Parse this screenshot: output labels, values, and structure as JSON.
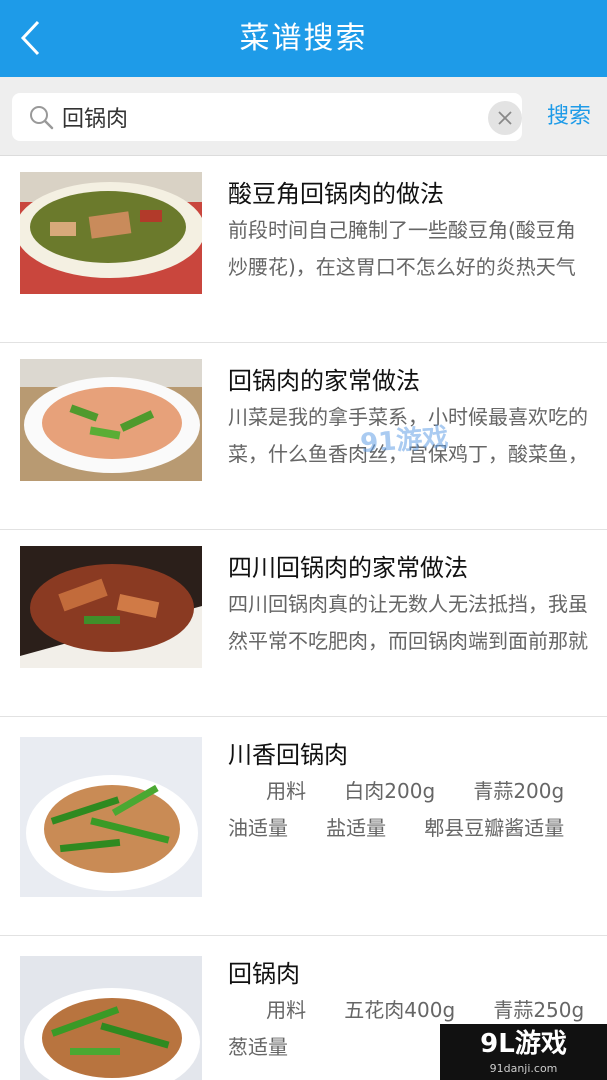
{
  "header": {
    "title": "菜谱搜索",
    "back_icon": "chevron-left-icon"
  },
  "search": {
    "value": "回锅肉",
    "button_label": "搜索"
  },
  "results": [
    {
      "title": "酸豆角回锅肉的做法",
      "desc": "前段时间自己腌制了一些酸豆角(酸豆角炒腰花)，在这胃口不怎么好的炎热天气"
    },
    {
      "title": "回锅肉的家常做法",
      "desc": "川菜是我的拿手菜系，小时候最喜欢吃的菜，什么鱼香肉丝，宫保鸡丁，酸菜鱼，"
    },
    {
      "title": "四川回锅肉的家常做法",
      "desc": "四川回锅肉真的让无数人无法抵挡，我虽然平常不吃肥肉，而回锅肉端到面前那就"
    },
    {
      "title": "川香回锅肉",
      "desc": "      用料      白肉200g      青蒜200g      油适量      盐适量      郫县豆瓣酱适量"
    },
    {
      "title": "回锅肉",
      "desc": "      用料      五花肉400g      青蒜250g      葱适量"
    }
  ],
  "watermark": "91游戏",
  "brand": {
    "logo": "9L游戏",
    "url": "91danji.com"
  },
  "colors": {
    "primary": "#1e9be8",
    "background": "#eeeeee"
  }
}
